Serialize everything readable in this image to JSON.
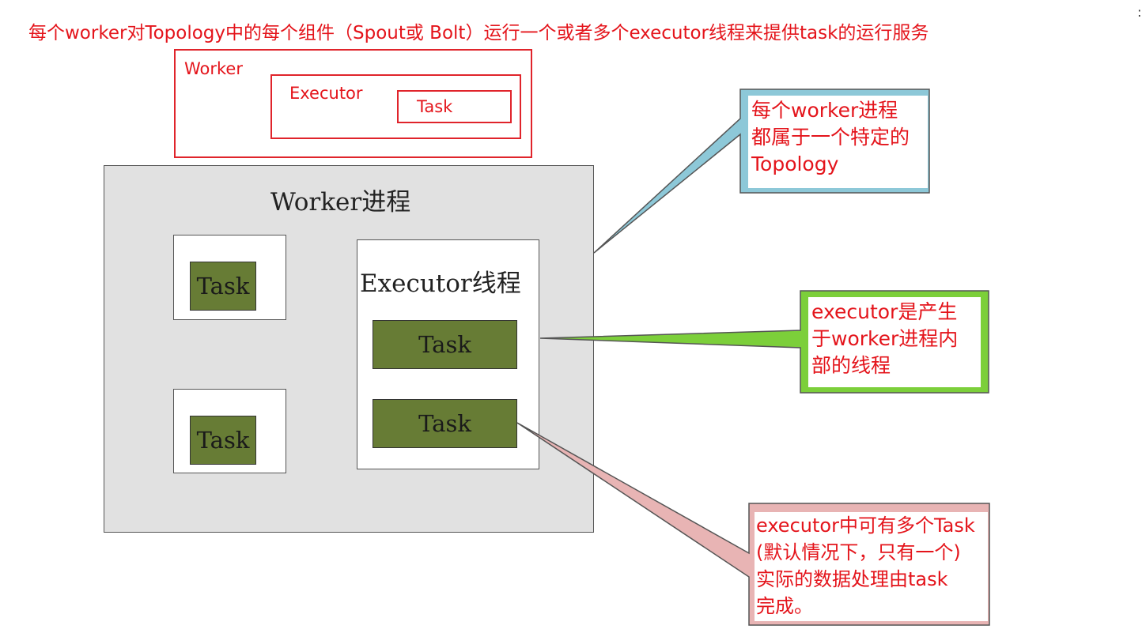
{
  "heading": "每个worker对Topology中的每个组件（Spout或 Bolt）运行一个或者多个executor线程来提供task的运行服务",
  "corner_mark": ":",
  "legend": {
    "worker_label": "Worker",
    "executor_label": "Executor",
    "task_label": "Task"
  },
  "diagram": {
    "worker_title": "Worker进程",
    "executor_title": "Executor线程",
    "task_label": "Task"
  },
  "callouts": {
    "blue": {
      "lines": [
        "每个worker进程",
        "都属于一个特定的",
        "Topology"
      ],
      "color": "#8dc8d8"
    },
    "green": {
      "lines": [
        "executor是产生",
        "于worker进程内",
        "部的线程"
      ],
      "color": "#7ccf3a"
    },
    "pink": {
      "lines": [
        "executor中可有多个Task",
        "(默认情况下，只有一个)",
        "实际的数据处理由task",
        "完成。"
      ],
      "color": "#e8b4b4"
    }
  },
  "colors": {
    "accent_red": "#e4141b",
    "task_green": "#677c35",
    "worker_gray": "#e1e1e1"
  }
}
